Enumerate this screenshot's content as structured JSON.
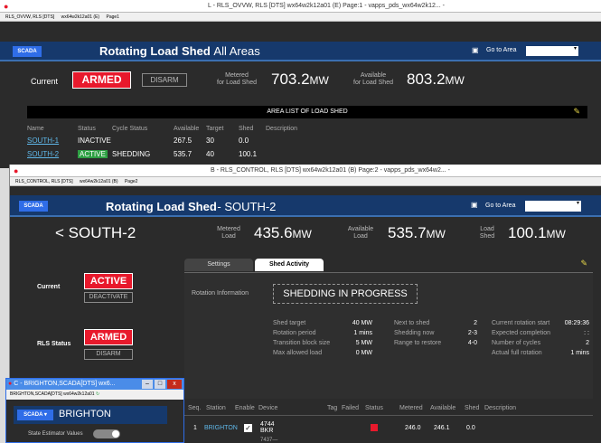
{
  "w1": {
    "title_bar": "L - RLS_OVVW, RLS [DTS]   wx64w2k12a01 (E)      Page:1 - vapps_pds_wx64w2k12... -",
    "tab_left": "RLS_OVVW, RLS [DTS]",
    "tab_host": "wx64w2k12a01 (E)",
    "tab_page": "Page1",
    "scada": "SCADA",
    "title": "Rotating Load Shed",
    "subtitle": "All Areas",
    "go_to_area": "Go to Area",
    "current_label": "Current",
    "armed": "ARMED",
    "disarm": "DISARM",
    "metered_label": "Metered\nfor Load Shed",
    "metered_value": "703.2",
    "available_label": "Available\nfor Load Shed",
    "available_value": "803.2",
    "unit": "MW",
    "area_list_title": "AREA LIST OF LOAD SHED",
    "table_headers": [
      "Name",
      "Status",
      "Cycle Status",
      "Available",
      "Target",
      "Shed",
      "Description"
    ],
    "rows": [
      {
        "name": "SOUTH-1",
        "status": "INACTIVE",
        "cycle": "",
        "available": "267.5",
        "target": "30",
        "shed": "0.0"
      },
      {
        "name": "SOUTH-2",
        "status": "ACTIVE",
        "cycle": "SHEDDING",
        "available": "535.7",
        "target": "40",
        "shed": "100.1"
      }
    ]
  },
  "w2": {
    "title_bar": "B - RLS_CONTROL, RLS [DTS]   wx64w2k12a01 (B)      Page:2 - vapps_pds_wx64w2... -",
    "tab_left": "RLS_CONTROL, RLS [DTS]",
    "tab_host": "wx64w2k12a01 (B)",
    "tab_page": "Page2",
    "scada": "SCADA",
    "title": "Rotating Load Shed",
    "subtitle": "SOUTH-2",
    "go_to_area": "Go to Area",
    "area_name": "SOUTH-2",
    "metered_label": "Metered\nLoad",
    "metered_value": "435.6",
    "available_label": "Available\nLoad",
    "available_value": "535.7",
    "shed_label": "Load\nShed",
    "shed_value": "100.1",
    "unit": "MW",
    "current_label": "Current",
    "active": "ACTIVE",
    "deactivate": "DEACTIVATE",
    "rls_status_label": "RLS Status",
    "armed": "ARMED",
    "disarm": "DISARM",
    "tab_settings": "Settings",
    "tab_shed_activity": "Shed Activity",
    "rotation_info": "Rotation Information",
    "shedding_banner": "SHEDDING IN PROGRESS",
    "info_col1": [
      {
        "k": "Shed target",
        "v": "40 MW"
      },
      {
        "k": "Rotation period",
        "v": "1 mins"
      },
      {
        "k": "Transition block size",
        "v": "5 MW"
      },
      {
        "k": "Max allowed load",
        "v": "0 MW"
      }
    ],
    "info_col2": [
      {
        "k": "Next to shed",
        "v": "2"
      },
      {
        "k": "Shedding now",
        "v": "2-3"
      },
      {
        "k": "Range to restore",
        "v": "4-0"
      }
    ],
    "info_col3": [
      {
        "k": "Current rotation start",
        "v": "08:29:36"
      },
      {
        "k": "Expected completion",
        "v": ":  :"
      },
      {
        "k": "Number of cycles",
        "v": "2"
      },
      {
        "k": "Actual full rotation",
        "v": "1 mins"
      }
    ],
    "feeder_headers": [
      "Seq.",
      "Station",
      "Enable",
      "Device",
      "Tag",
      "Failed",
      "Status",
      "Metered",
      "Available",
      "Shed",
      "Description"
    ],
    "feeder_row": {
      "seq": "1",
      "station": "BRIGHTON",
      "device": "4744\nBKR",
      "metered": "246.0",
      "available": "246.1",
      "shed": "0.0"
    },
    "feeder_row2_device": "7437—"
  },
  "w3": {
    "title_bar": "C - BRIGHTON,SCADA[DTS]   wx6...",
    "tab_left": "BRIGHTON,SCADA[DTS]",
    "tab_host": "wx64w2k12a01",
    "scada": "SCADA",
    "title": "BRIGHTON",
    "state_estimator": "State Estimator Values"
  }
}
